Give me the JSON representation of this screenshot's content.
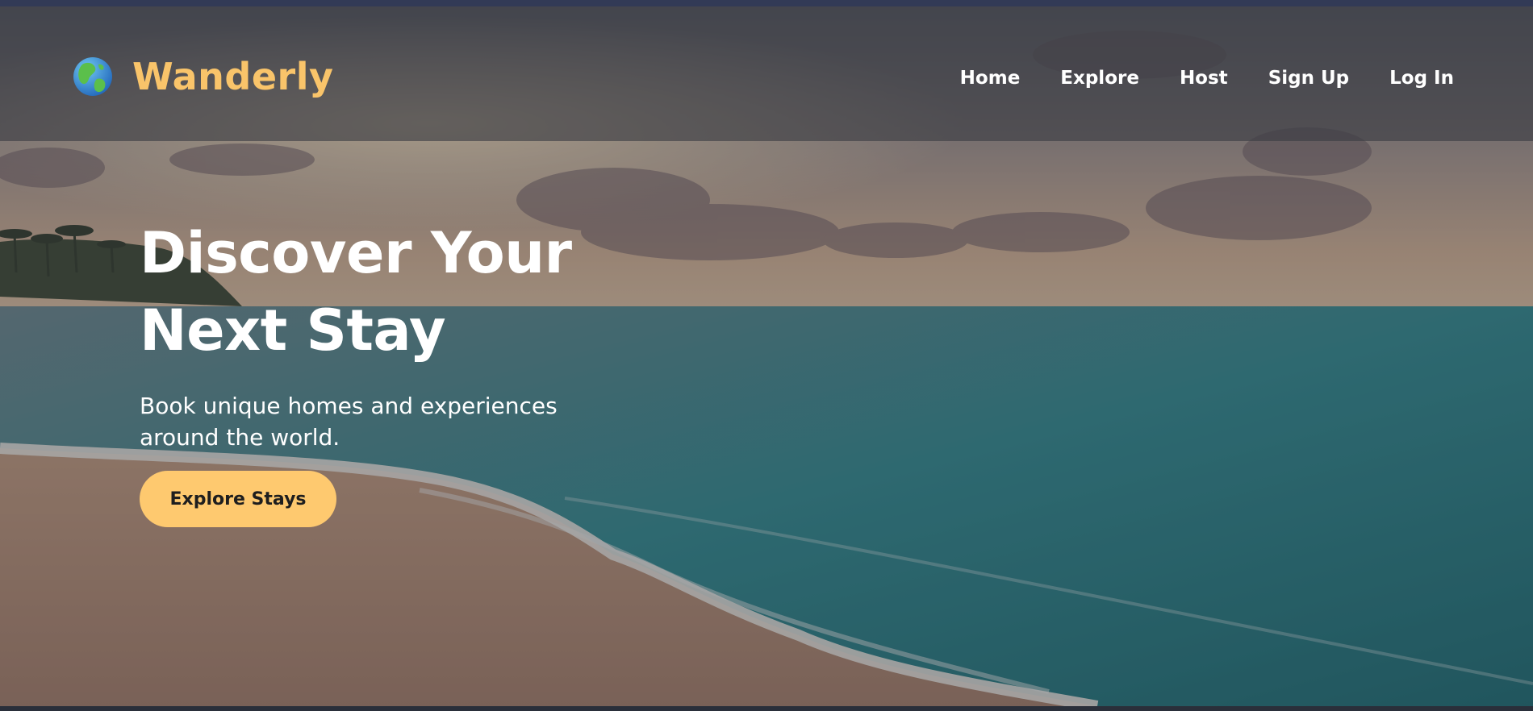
{
  "brand": {
    "name": "Wanderly",
    "logo_icon": "globe-icon"
  },
  "nav": {
    "links": [
      "Home",
      "Explore",
      "Host",
      "Sign Up",
      "Log In"
    ]
  },
  "hero": {
    "title_line1": "Discover Your",
    "title_line2": "Next Stay",
    "subtitle": "Book unique homes and experiences around the world.",
    "cta_label": "Explore Stays",
    "background": "beach-sunset-image"
  },
  "colors": {
    "accent": "#fec96f",
    "brand_text": "#f9c46a",
    "nav_text": "#ffffff"
  }
}
